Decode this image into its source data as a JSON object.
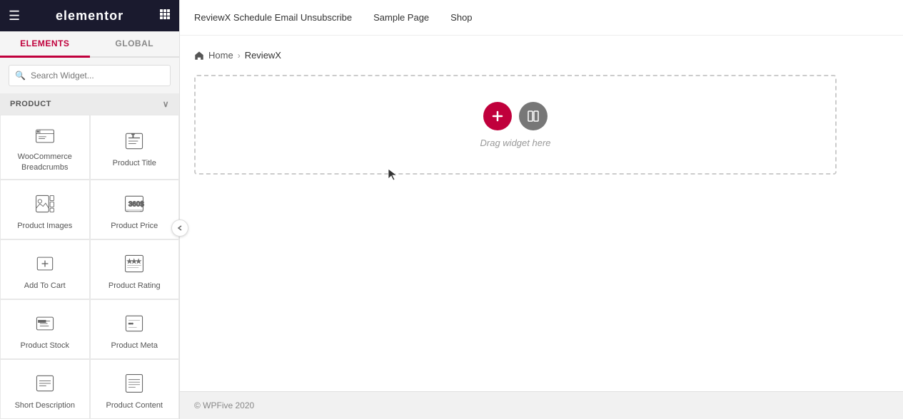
{
  "header": {
    "hamburger_icon": "☰",
    "logo_text": "elementor",
    "apps_icon": "⋮⋮⋮"
  },
  "tabs": [
    {
      "id": "elements",
      "label": "ELEMENTS",
      "active": true
    },
    {
      "id": "global",
      "label": "GLOBAL",
      "active": false
    }
  ],
  "search": {
    "placeholder": "Search Widget..."
  },
  "section": {
    "label": "PRODUCT",
    "chevron": "∨"
  },
  "widgets": [
    {
      "id": "woocommerce-breadcrumbs",
      "label": "WooCommerce Breadcrumbs",
      "icon": "breadcrumb"
    },
    {
      "id": "product-title",
      "label": "Product Title",
      "icon": "title"
    },
    {
      "id": "product-images",
      "label": "Product Images",
      "icon": "images"
    },
    {
      "id": "product-price",
      "label": "Product Price",
      "icon": "price"
    },
    {
      "id": "add-to-cart",
      "label": "Add To Cart",
      "icon": "cart"
    },
    {
      "id": "product-rating",
      "label": "Product Rating",
      "icon": "rating"
    },
    {
      "id": "product-stock",
      "label": "Product Stock",
      "icon": "stock"
    },
    {
      "id": "product-meta",
      "label": "Product Meta",
      "icon": "meta"
    },
    {
      "id": "short-description",
      "label": "Short Description",
      "icon": "description"
    },
    {
      "id": "product-content",
      "label": "Product Content",
      "icon": "content"
    }
  ],
  "nav_links": [
    {
      "id": "reviewx-schedule",
      "label": "ReviewX Schedule Email Unsubscribe"
    },
    {
      "id": "sample-page",
      "label": "Sample Page"
    },
    {
      "id": "shop",
      "label": "Shop"
    }
  ],
  "breadcrumb": {
    "home_label": "Home",
    "separator": "›",
    "current": "ReviewX"
  },
  "drop_zone": {
    "drag_text": "Drag widget here"
  },
  "footer": {
    "text": "© WPFive 2020"
  },
  "colors": {
    "active_tab": "#c0003c",
    "btn_add": "#c0003c",
    "btn_layout": "#777777"
  }
}
